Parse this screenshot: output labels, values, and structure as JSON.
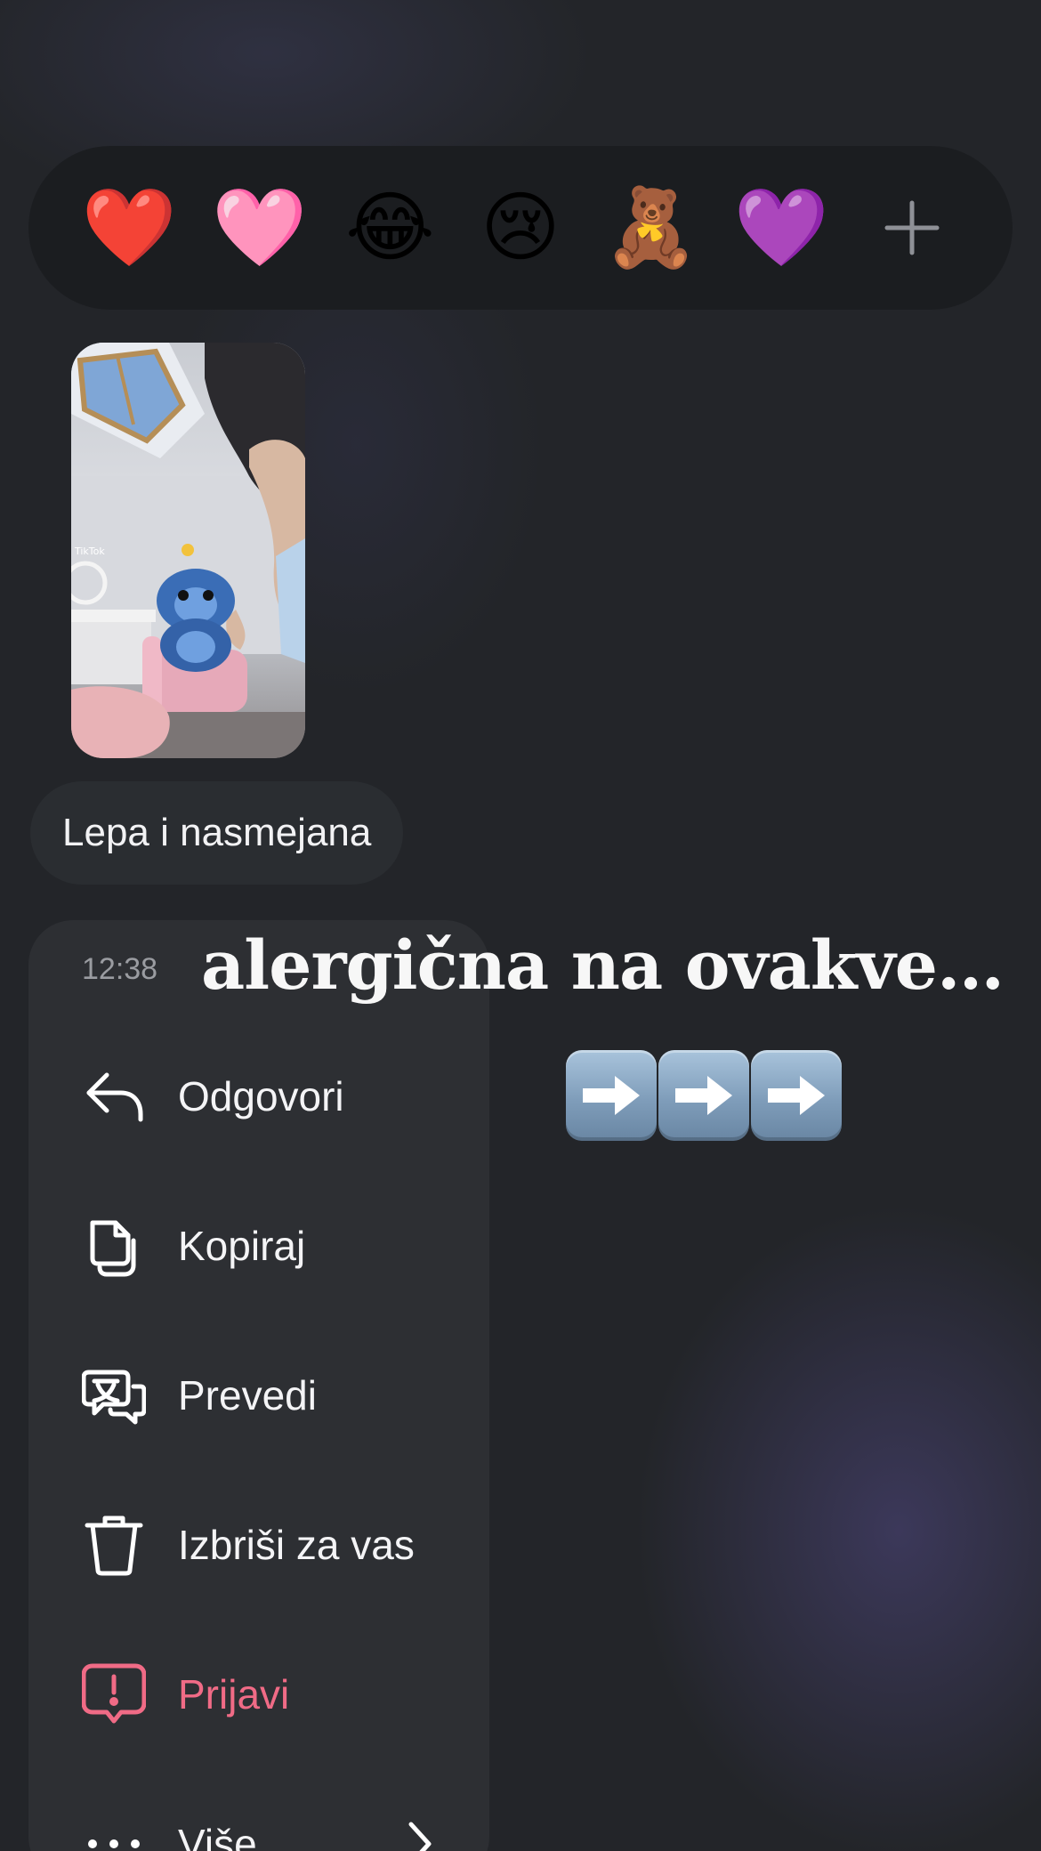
{
  "reactions": {
    "items": [
      {
        "emoji": "❤️",
        "name": "red-heart"
      },
      {
        "emoji": "🩷",
        "name": "pink-heart"
      },
      {
        "emoji": "😂",
        "name": "tears-of-joy"
      },
      {
        "emoji": "😢",
        "name": "crying-face"
      },
      {
        "emoji": "🧸",
        "name": "teddy-bear"
      },
      {
        "emoji": "💜",
        "name": "purple-heart"
      }
    ],
    "more_icon": "plus-icon"
  },
  "message": {
    "thumbnail_watermark": "TikTok",
    "caption": "Lepa i nasmejana"
  },
  "headline": "alergična na ovakve…",
  "arrows_emoji": "➡️➡️➡️",
  "menu": {
    "time": "12:38",
    "items": [
      {
        "label": "Odgovori",
        "icon": "reply-icon"
      },
      {
        "label": "Kopiraj",
        "icon": "copy-icon"
      },
      {
        "label": "Prevedi",
        "icon": "translate-icon"
      },
      {
        "label": "Izbriši za vas",
        "icon": "trash-icon"
      },
      {
        "label": "Prijavi",
        "icon": "report-icon",
        "color": "#f06b86"
      },
      {
        "label": "Više",
        "icon": "more-icon"
      }
    ]
  },
  "colors": {
    "background": "#232529",
    "menu": "#2d2f33",
    "danger": "#f06b86"
  }
}
